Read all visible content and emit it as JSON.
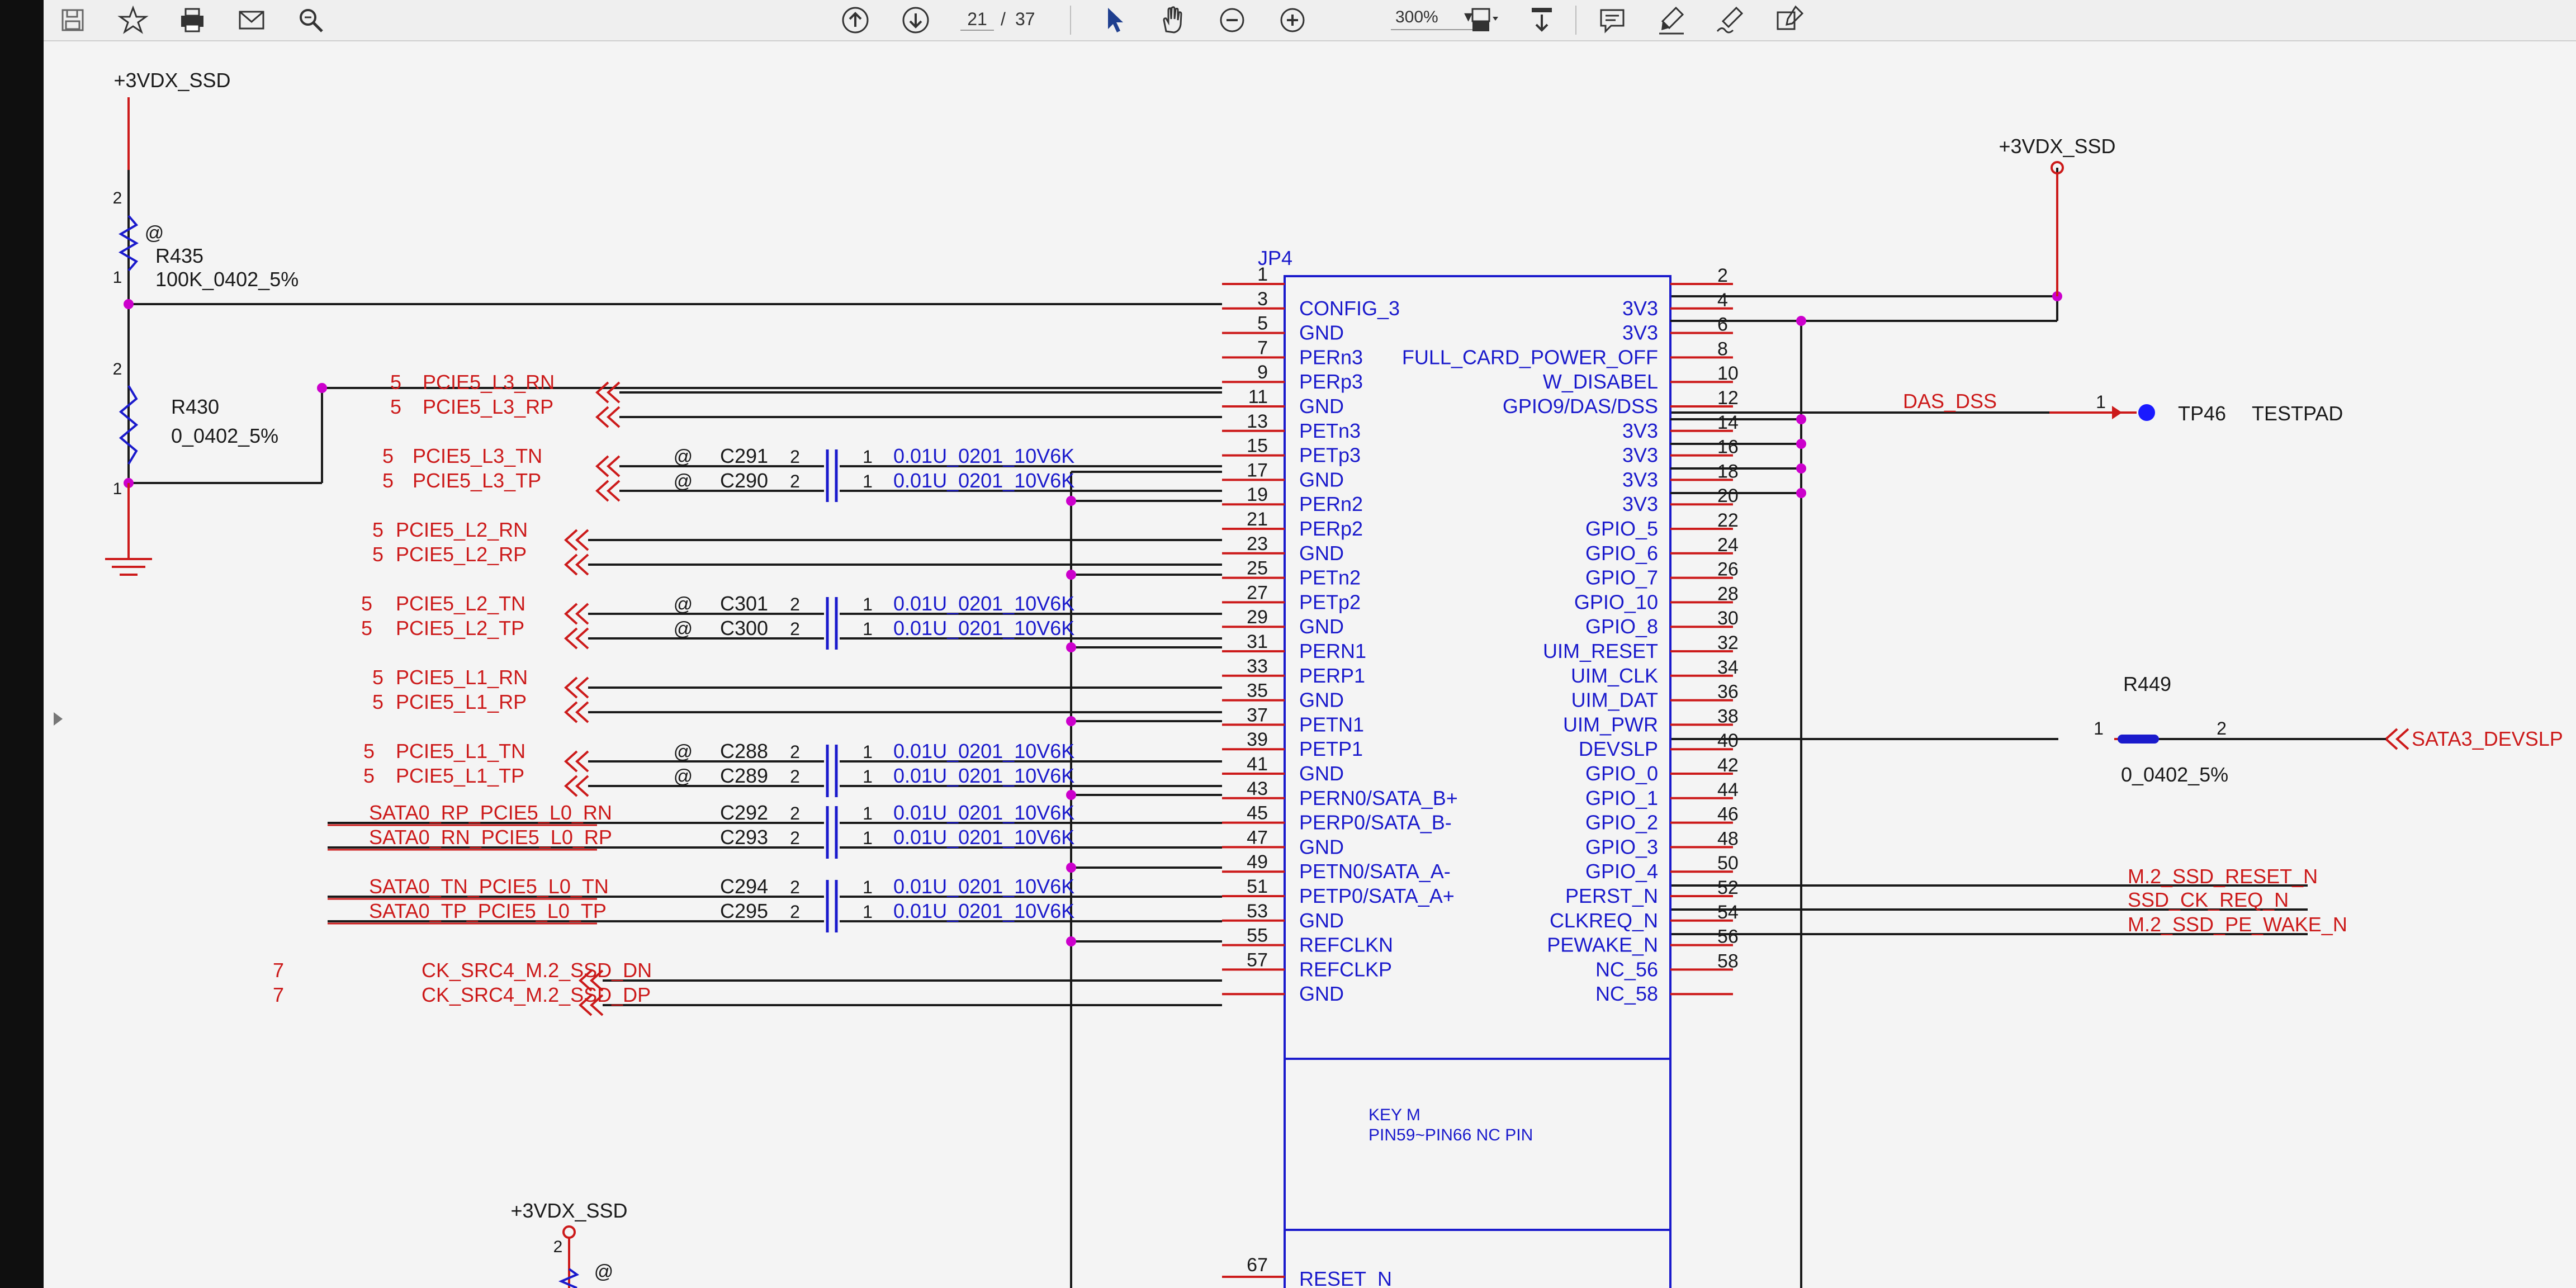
{
  "toolbar": {
    "page_current": "21",
    "page_separator": "/",
    "page_total": "37",
    "zoom": "300%",
    "zoom_arrow": "▾",
    "icons": [
      "save-icon",
      "bookmark-icon",
      "print-icon",
      "mail-icon",
      "search-icon",
      "page-up-icon",
      "page-down-icon",
      "select-tool-icon",
      "hand-tool-icon",
      "zoom-out-icon",
      "zoom-in-icon",
      "fit-page-icon",
      "scroll-mode-icon",
      "comment-icon",
      "highlight-icon",
      "sign-icon",
      "tools-icon"
    ]
  },
  "schematic": {
    "colors": {
      "net": "#cc1a1a",
      "wire": "#1a1a1a",
      "part": "#1a1acc",
      "junction": "#cc00cc",
      "dot": "#1a1aff"
    },
    "power_top_left": "+3VDX_SSD",
    "power_top_right": "+3VDX_SSD",
    "power_bottom": "+3VDX_SSD",
    "r435": {
      "at": "@",
      "ref": "R435",
      "val": "100K_0402_5%",
      "pin_top": "2",
      "pin_bot": "1"
    },
    "r430": {
      "ref": "R430",
      "val": "0_0402_5%",
      "pin_top": "2",
      "pin_bot": "1"
    },
    "bottom_res": {
      "pin": "2",
      "at": "@"
    },
    "jp4": {
      "ref": "JP4",
      "left_pins": [
        {
          "num": "1",
          "name": ""
        },
        {
          "num": "3",
          "name": "CONFIG_3"
        },
        {
          "num": "5",
          "name": "GND"
        },
        {
          "num": "7",
          "name": "PERn3"
        },
        {
          "num": "9",
          "name": "PERp3"
        },
        {
          "num": "11",
          "name": "GND"
        },
        {
          "num": "13",
          "name": "PETn3"
        },
        {
          "num": "15",
          "name": "PETp3"
        },
        {
          "num": "17",
          "name": "GND"
        },
        {
          "num": "19",
          "name": "PERn2"
        },
        {
          "num": "21",
          "name": "PERp2"
        },
        {
          "num": "23",
          "name": "GND"
        },
        {
          "num": "25",
          "name": "PETn2"
        },
        {
          "num": "27",
          "name": "PETp2"
        },
        {
          "num": "29",
          "name": "GND"
        },
        {
          "num": "31",
          "name": "PERN1"
        },
        {
          "num": "33",
          "name": "PERP1"
        },
        {
          "num": "35",
          "name": "GND"
        },
        {
          "num": "37",
          "name": "PETN1"
        },
        {
          "num": "39",
          "name": "PETP1"
        },
        {
          "num": "41",
          "name": "GND"
        },
        {
          "num": "43",
          "name": "PERN0/SATA_B+"
        },
        {
          "num": "45",
          "name": "PERP0/SATA_B-"
        },
        {
          "num": "47",
          "name": "GND"
        },
        {
          "num": "49",
          "name": "PETN0/SATA_A-"
        },
        {
          "num": "51",
          "name": "PETP0/SATA_A+"
        },
        {
          "num": "53",
          "name": "GND"
        },
        {
          "num": "55",
          "name": "REFCLKN"
        },
        {
          "num": "57",
          "name": "REFCLKP"
        },
        {
          "num": "",
          "name": "GND"
        }
      ],
      "right_pins": [
        {
          "num": "2",
          "name": ""
        },
        {
          "num": "4",
          "name": "3V3"
        },
        {
          "num": "6",
          "name": "3V3"
        },
        {
          "num": "8",
          "name": "FULL_CARD_POWER_OFF"
        },
        {
          "num": "10",
          "name": "W_DISABEL"
        },
        {
          "num": "12",
          "name": "GPIO9/DAS/DSS"
        },
        {
          "num": "14",
          "name": "3V3"
        },
        {
          "num": "16",
          "name": "3V3"
        },
        {
          "num": "18",
          "name": "3V3"
        },
        {
          "num": "20",
          "name": "3V3"
        },
        {
          "num": "22",
          "name": "GPIO_5"
        },
        {
          "num": "24",
          "name": "GPIO_6"
        },
        {
          "num": "26",
          "name": "GPIO_7"
        },
        {
          "num": "28",
          "name": "GPIO_10"
        },
        {
          "num": "30",
          "name": "GPIO_8"
        },
        {
          "num": "32",
          "name": "UIM_RESET"
        },
        {
          "num": "34",
          "name": "UIM_CLK"
        },
        {
          "num": "36",
          "name": "UIM_DAT"
        },
        {
          "num": "38",
          "name": "UIM_PWR"
        },
        {
          "num": "40",
          "name": "DEVSLP"
        },
        {
          "num": "42",
          "name": "GPIO_0"
        },
        {
          "num": "44",
          "name": "GPIO_1"
        },
        {
          "num": "46",
          "name": "GPIO_2"
        },
        {
          "num": "48",
          "name": "GPIO_3"
        },
        {
          "num": "50",
          "name": "GPIO_4"
        },
        {
          "num": "52",
          "name": "PERST_N"
        },
        {
          "num": "54",
          "name": "CLKREQ_N"
        },
        {
          "num": "56",
          "name": "PEWAKE_N"
        },
        {
          "num": "58",
          "name": "NC_56"
        },
        {
          "num": "",
          "name": "NC_58"
        }
      ],
      "key_text": "KEY M",
      "key_sub": "PIN59~PIN66 NC PIN",
      "pin67_num": "67",
      "pin67_name": "RESET_N"
    },
    "left_nets": [
      {
        "prefix": "5",
        "label": "PCIE5_L3_RN"
      },
      {
        "prefix": "5",
        "label": "PCIE5_L3_RP"
      },
      {
        "prefix": "5",
        "label": "PCIE5_L3_TN"
      },
      {
        "prefix": "5",
        "label": "PCIE5_L3_TP"
      },
      {
        "prefix": "5",
        "label": "PCIE5_L2_RN"
      },
      {
        "prefix": "5",
        "label": "PCIE5_L2_RP"
      },
      {
        "prefix": "5",
        "label": "PCIE5_L2_TN"
      },
      {
        "prefix": "5",
        "label": "PCIE5_L2_TP"
      },
      {
        "prefix": "5",
        "label": "PCIE5_L1_RN"
      },
      {
        "prefix": "5",
        "label": "PCIE5_L1_RP"
      },
      {
        "prefix": "5",
        "label": "PCIE5_L1_TN"
      },
      {
        "prefix": "5",
        "label": "PCIE5_L1_TP"
      },
      {
        "prefix": "",
        "label": "SATA0_RP_PCIE5_L0_RN"
      },
      {
        "prefix": "",
        "label": "SATA0_RN_PCIE5_L0_RP"
      },
      {
        "prefix": "",
        "label": "SATA0_TN_PCIE5_L0_TN"
      },
      {
        "prefix": "",
        "label": "SATA0_TP_PCIE5_L0_TP"
      },
      {
        "prefix": "7",
        "label": "CK_SRC4_M.2_SSD_DN"
      },
      {
        "prefix": "7",
        "label": "CK_SRC4_M.2_SSD_DP"
      }
    ],
    "caps": [
      {
        "at": "@",
        "ref": "C291",
        "p2": "2",
        "p1": "1",
        "val": "0.01U_0201_10V6K"
      },
      {
        "at": "@",
        "ref": "C290",
        "p2": "2",
        "p1": "1",
        "val": "0.01U_0201_10V6K"
      },
      {
        "at": "@",
        "ref": "C301",
        "p2": "2",
        "p1": "1",
        "val": "0.01U_0201_10V6K"
      },
      {
        "at": "@",
        "ref": "C300",
        "p2": "2",
        "p1": "1",
        "val": "0.01U_0201_10V6K"
      },
      {
        "at": "@",
        "ref": "C288",
        "p2": "2",
        "p1": "1",
        "val": "0.01U_0201_10V6K"
      },
      {
        "at": "@",
        "ref": "C289",
        "p2": "2",
        "p1": "1",
        "val": "0.01U_0201_10V6K"
      },
      {
        "at": "",
        "ref": "C292",
        "p2": "2",
        "p1": "1",
        "val": "0.01U_0201_10V6K"
      },
      {
        "at": "",
        "ref": "C293",
        "p2": "2",
        "p1": "1",
        "val": "0.01U_0201_10V6K"
      },
      {
        "at": "",
        "ref": "C294",
        "p2": "2",
        "p1": "1",
        "val": "0.01U_0201_10V6K"
      },
      {
        "at": "",
        "ref": "C295",
        "p2": "2",
        "p1": "1",
        "val": "0.01U_0201_10V6K"
      }
    ],
    "das_dss": {
      "net": "DAS_DSS",
      "pin": "1",
      "ref": "TP46",
      "name": "TESTPAD"
    },
    "r449": {
      "ref": "R449",
      "pin1": "1",
      "pin2": "2",
      "val": "0_0402_5%",
      "net": "SATA3_DEVSLP"
    },
    "right_nets": [
      "M.2_SSD_RESET_N",
      "SSD_CK_REQ_N",
      "M.2_SSD_PE_WAKE_N"
    ]
  }
}
